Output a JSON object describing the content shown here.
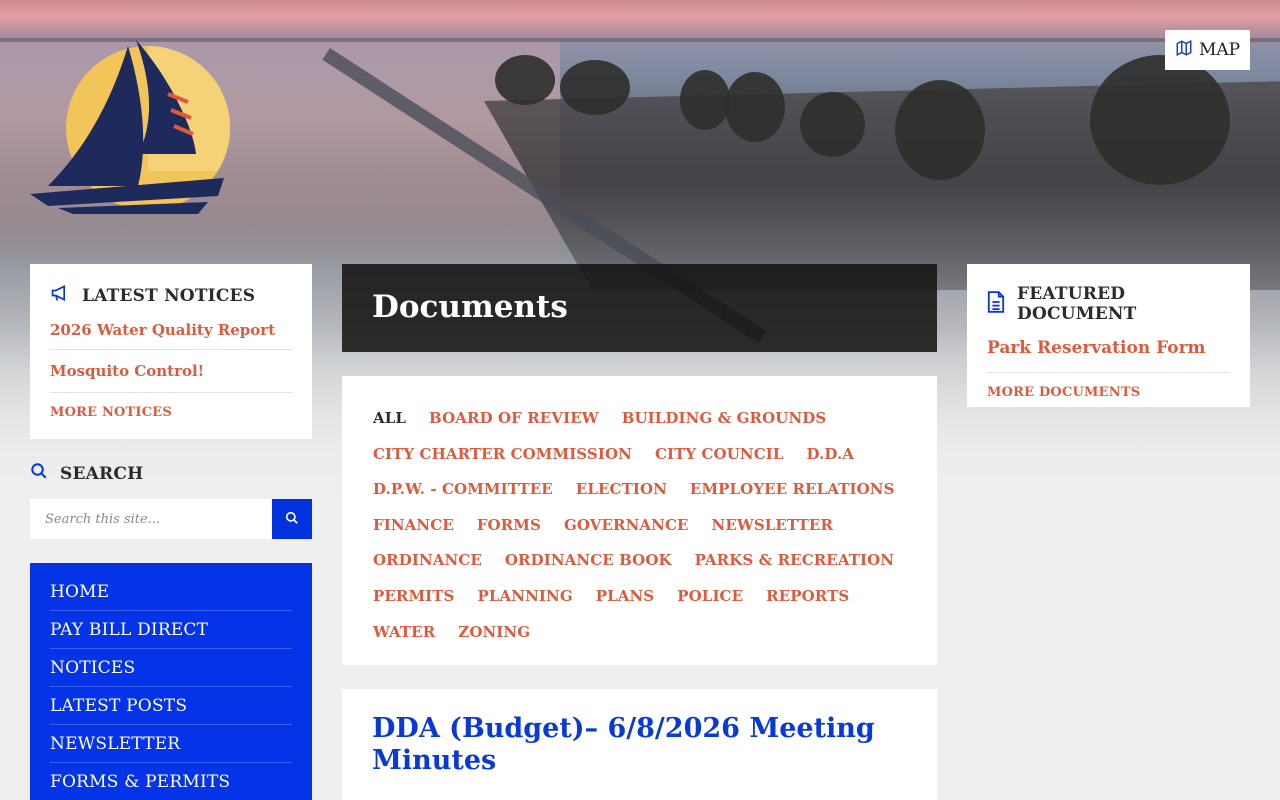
{
  "header": {
    "map_label": "MAP"
  },
  "latest_notices": {
    "heading": "LATEST NOTICES",
    "items": [
      "2026 Water Quality Report",
      "Mosquito Control!"
    ],
    "more_label": "MORE NOTICES"
  },
  "search": {
    "heading": "SEARCH",
    "placeholder": "Search this site..."
  },
  "nav": {
    "items": [
      "HOME",
      "PAY BILL DIRECT",
      "NOTICES",
      "LATEST POSTS",
      "NEWSLETTER",
      "FORMS & PERMITS"
    ]
  },
  "main": {
    "title": "Documents",
    "categories": [
      "ALL",
      "BOARD OF REVIEW",
      "BUILDING & GROUNDS",
      "CITY CHARTER COMMISSION",
      "CITY COUNCIL",
      "D.D.A",
      "D.P.W. - COMMITTEE",
      "ELECTION",
      "EMPLOYEE RELATIONS",
      "FINANCE",
      "FORMS",
      "GOVERNANCE",
      "NEWSLETTER",
      "ORDINANCE",
      "ORDINANCE BOOK",
      "PARKS & RECREATION",
      "PERMITS",
      "PLANNING",
      "PLANS",
      "POLICE",
      "REPORTS",
      "WATER",
      "ZONING"
    ],
    "active_category": "ALL",
    "post_title": "DDA (Budget)– 6/8/2026 Meeting Minutes"
  },
  "featured": {
    "heading": "FEATURED DOCUMENT",
    "link": "Park Reservation Form",
    "more_label": "MORE DOCUMENTS"
  },
  "colors": {
    "accent_orange": "#de5a3c",
    "nav_blue": "#0533e8",
    "link_blue": "#0a3ad6",
    "logo_navy": "#1f2a5c",
    "logo_gold": "#f2c55a"
  },
  "icons": {
    "map": "map-icon",
    "notices": "megaphone-icon",
    "search": "search-icon",
    "featured": "document-icon"
  }
}
